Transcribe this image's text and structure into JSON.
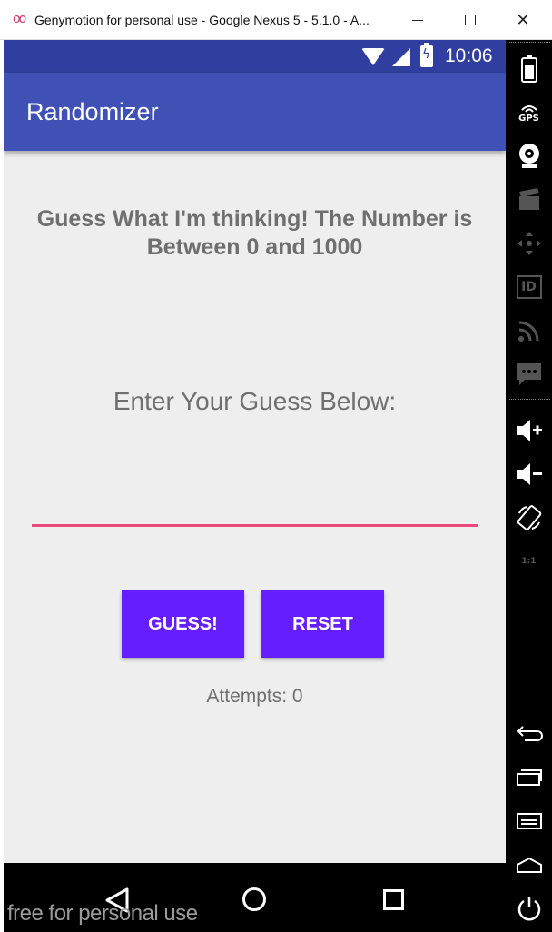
{
  "window": {
    "title": "Genymotion for personal use - Google Nexus 5 - 5.1.0 - A...",
    "logo_glyph": "oo",
    "minimize_icon": "minimize-icon",
    "maximize_icon": "maximize-icon",
    "close_glyph": "✕"
  },
  "status_bar": {
    "time": "10:06",
    "color": "#303f9f"
  },
  "app_bar": {
    "title": "Randomizer",
    "color": "#3f51b5"
  },
  "main": {
    "headline": "Guess What I'm thinking! The Number is Between 0 and 1000",
    "prompt": "Enter Your Guess Below:",
    "input_value": "",
    "input_underline_color": "#e94a7b",
    "guess_button_label": "GUESS!",
    "reset_button_label": "RESET",
    "button_color": "#651fff",
    "attempts_text": "Attempts: 0"
  },
  "watermark": "free for personal use",
  "sidebar": {
    "items": [
      {
        "icon": "battery-icon"
      },
      {
        "icon": "gps-icon",
        "label": "GPS"
      },
      {
        "icon": "webcam-icon"
      },
      {
        "icon": "clapperboard-icon"
      },
      {
        "icon": "dpad-icon"
      },
      {
        "icon": "id-icon",
        "label": "ID"
      },
      {
        "icon": "rss-icon"
      },
      {
        "icon": "sms-icon"
      },
      {
        "icon": "volume-up-icon"
      },
      {
        "icon": "volume-down-icon"
      },
      {
        "icon": "rotate-icon"
      },
      {
        "icon": "pixel-perfect-icon",
        "label": "1:1"
      },
      {
        "icon": "back-icon"
      },
      {
        "icon": "recent-apps-icon"
      },
      {
        "icon": "menu-icon"
      },
      {
        "icon": "home-icon"
      },
      {
        "icon": "power-icon"
      }
    ]
  }
}
